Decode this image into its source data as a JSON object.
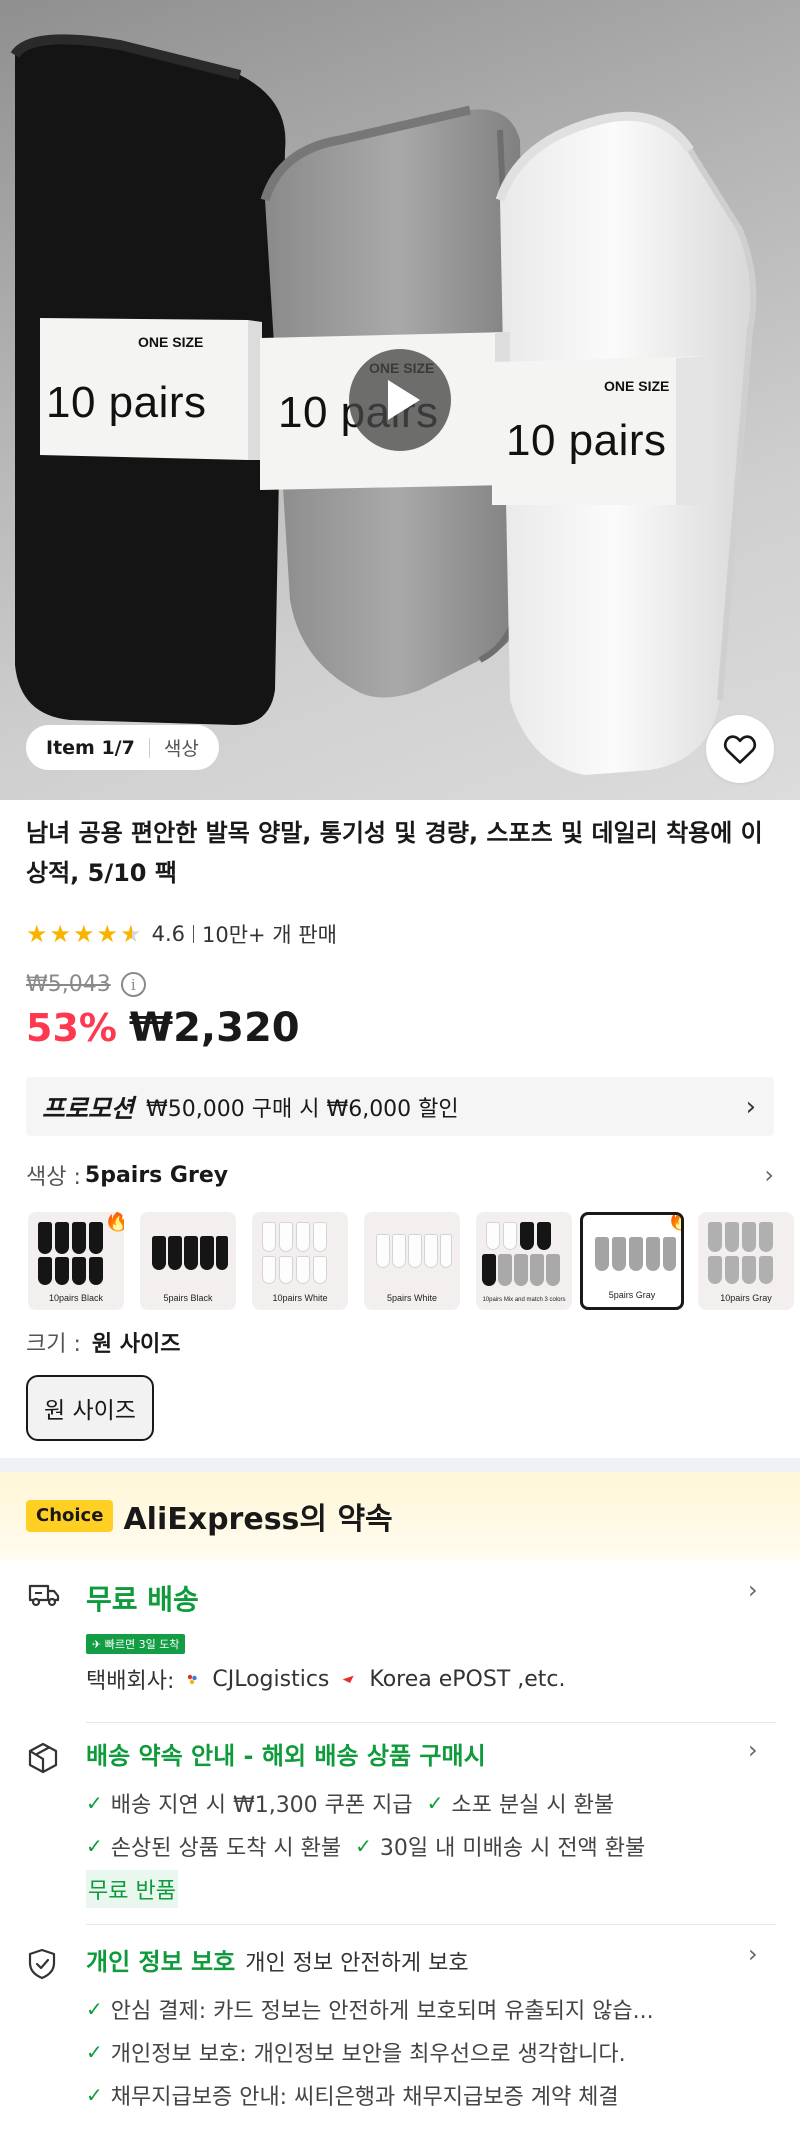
{
  "hero": {
    "band_label": "10 pairs",
    "size_label": "ONE SIZE",
    "pill_item": "Item 1/7",
    "pill_type": "색상"
  },
  "product": {
    "title": "남녀 공용 편안한 발목 양말, 통기성 및 경량, 스포츠 및 데일리 착용에 이상적, 5/10 팩",
    "rating": "4.6",
    "rating_stars": 4.6,
    "sold": "10만+ 개 판매",
    "original_price": "₩5,043",
    "discount": "53%",
    "price": "₩2,320"
  },
  "promo": {
    "tag": "프로모션",
    "text": "₩50,000 구매 시 ₩6,000 할인"
  },
  "color": {
    "label": "색상 :",
    "value": "5pairs Grey",
    "options": [
      {
        "caption": "10pairs Black",
        "hot": true
      },
      {
        "caption": "5pairs Black",
        "hot": false
      },
      {
        "caption": "10pairs White",
        "hot": false
      },
      {
        "caption": "5pairs White",
        "hot": false
      },
      {
        "caption": "10pairs Mix and match 3 colors",
        "hot": false
      },
      {
        "caption": "5pairs Gray",
        "hot": true,
        "selected": true
      },
      {
        "caption": "10pairs Gray",
        "hot": false
      }
    ]
  },
  "size": {
    "label": "크기 :",
    "value": "원 사이즈",
    "option": "원 사이즈"
  },
  "promise": {
    "badge": "Choice",
    "title": "AliExpress의 약속",
    "shipping": {
      "title": "무료 배송",
      "fast_badge": "빠르면 3일 도착",
      "carrier_label": "택배회사:",
      "carrier_1": "CJLogistics",
      "carrier_2": "Korea ePOST ,etc."
    },
    "delivery": {
      "title": "배송 약속 안내 - 해외 배송 상품 구매시",
      "items": [
        "배송 지연 시 ₩1,300 쿠폰 지급",
        "소포 분실 시 환불",
        "손상된 상품 도착 시 환불",
        "30일 내 미배송 시 전액 환불"
      ],
      "free_return": "무료 반품"
    },
    "privacy": {
      "title": "개인 정보 보호",
      "subtitle": "개인 정보 안전하게 보호",
      "items": [
        "안심 결제: 카드 정보는 안전하게 보호되며 유출되지 않습...",
        "개인정보 보호: 개인정보 보안을 최우선으로 생각합니다.",
        "채무지급보증 안내: 씨티은행과 채무지급보증 계약 체결"
      ]
    }
  },
  "colors": {
    "accent_red": "#fd384f",
    "green": "#0f9b3c",
    "choice_yellow": "#ffcf24",
    "star": "#f7b500"
  }
}
